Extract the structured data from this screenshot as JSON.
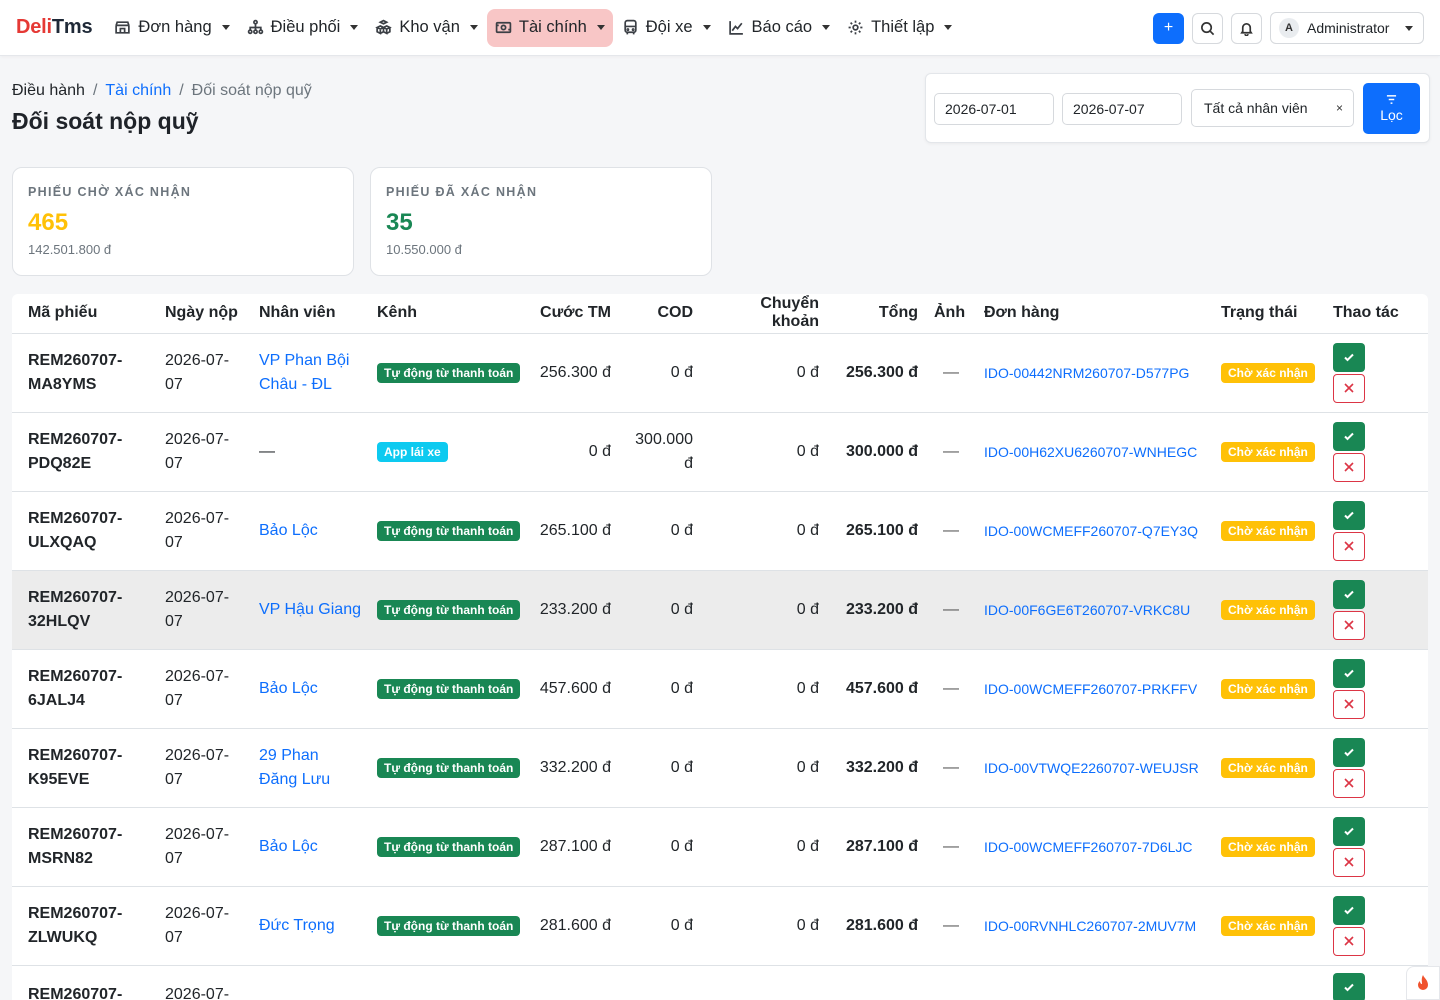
{
  "brand": {
    "part1": "Deli",
    "part2": "Tms"
  },
  "nav": [
    {
      "label": "Đơn hàng",
      "icon": "store-icon",
      "active": false
    },
    {
      "label": "Điều phối",
      "icon": "network-icon",
      "active": false
    },
    {
      "label": "Kho vận",
      "icon": "boxes-icon",
      "active": false
    },
    {
      "label": "Tài chính",
      "icon": "cash-icon",
      "active": true
    },
    {
      "label": "Đội xe",
      "icon": "bus-icon",
      "active": false
    },
    {
      "label": "Báo cáo",
      "icon": "chart-line-icon",
      "active": false
    },
    {
      "label": "Thiết lập",
      "icon": "gear-icon",
      "active": false
    }
  ],
  "navbar_right": {
    "add": "+",
    "user_initial": "A",
    "user_name": "Administrator"
  },
  "breadcrumb": {
    "root": "Điều hành",
    "parent": "Tài chính",
    "current": "Đối soát nộp quỹ"
  },
  "page_title": "Đối soát nộp quỹ",
  "filter": {
    "date_from": "2026-07-01",
    "date_to": "2026-07-07",
    "staff": "Tất cả nhân viên",
    "clear": "×",
    "button": "Lọc"
  },
  "stats": {
    "pending": {
      "label": "PHIẾU CHỜ XÁC NHẬN",
      "count": "465",
      "amount": "142.501.800 đ",
      "color": "#ffc107"
    },
    "confirmed": {
      "label": "PHIẾU ĐÃ XÁC NHẬN",
      "count": "35",
      "amount": "10.550.000 đ",
      "color": "#198754"
    }
  },
  "table": {
    "headers": [
      "Mã phiếu",
      "Ngày nộp",
      "Nhân viên",
      "Kênh",
      "Cước TM",
      "COD",
      "Chuyển khoản",
      "Tổng",
      "Ảnh",
      "Đơn hàng",
      "Trạng thái",
      "Thao tác"
    ],
    "rows": [
      {
        "code": "REM260707-MA8YMS",
        "date": "2026-07-07",
        "staff": "VP Phan Bội Châu - ĐL",
        "channel": "Tự động từ thanh toán",
        "channel_type": "auto",
        "cash": "256.300 đ",
        "cod": "0 đ",
        "transfer": "0 đ",
        "total": "256.300 đ",
        "img": "—",
        "order": "IDO-00442NRM260707-D577PG",
        "status": "Chờ xác nhận"
      },
      {
        "code": "REM260707-PDQ82E",
        "date": "2026-07-07",
        "staff": "—",
        "channel": "App lái xe",
        "channel_type": "app",
        "cash": "0 đ",
        "cod": "300.000 đ",
        "transfer": "0 đ",
        "total": "300.000 đ",
        "img": "—",
        "order": "IDO-00H62XU6260707-WNHEGC",
        "status": "Chờ xác nhận"
      },
      {
        "code": "REM260707-ULXQAQ",
        "date": "2026-07-07",
        "staff": "Bảo Lộc",
        "channel": "Tự động từ thanh toán",
        "channel_type": "auto",
        "cash": "265.100 đ",
        "cod": "0 đ",
        "transfer": "0 đ",
        "total": "265.100 đ",
        "img": "—",
        "order": "IDO-00WCMEFF260707-Q7EY3Q",
        "status": "Chờ xác nhận"
      },
      {
        "code": "REM260707-32HLQV",
        "date": "2026-07-07",
        "staff": "VP Hậu Giang",
        "channel": "Tự động từ thanh toán",
        "channel_type": "auto",
        "cash": "233.200 đ",
        "cod": "0 đ",
        "transfer": "0 đ",
        "total": "233.200 đ",
        "img": "—",
        "order": "IDO-00F6GE6T260707-VRKC8U",
        "status": "Chờ xác nhận",
        "highlight": true
      },
      {
        "code": "REM260707-6JALJ4",
        "date": "2026-07-07",
        "staff": "Bảo Lộc",
        "channel": "Tự động từ thanh toán",
        "channel_type": "auto",
        "cash": "457.600 đ",
        "cod": "0 đ",
        "transfer": "0 đ",
        "total": "457.600 đ",
        "img": "—",
        "order": "IDO-00WCMEFF260707-PRKFFV",
        "status": "Chờ xác nhận"
      },
      {
        "code": "REM260707-K95EVE",
        "date": "2026-07-07",
        "staff": "29 Phan Đăng Lưu",
        "channel": "Tự động từ thanh toán",
        "channel_type": "auto",
        "cash": "332.200 đ",
        "cod": "0 đ",
        "transfer": "0 đ",
        "total": "332.200 đ",
        "img": "—",
        "order": "IDO-00VTWQE2260707-WEUJSR",
        "status": "Chờ xác nhận"
      },
      {
        "code": "REM260707-MSRN82",
        "date": "2026-07-07",
        "staff": "Bảo Lộc",
        "channel": "Tự động từ thanh toán",
        "channel_type": "auto",
        "cash": "287.100 đ",
        "cod": "0 đ",
        "transfer": "0 đ",
        "total": "287.100 đ",
        "img": "—",
        "order": "IDO-00WCMEFF260707-7D6LJC",
        "status": "Chờ xác nhận"
      },
      {
        "code": "REM260707-ZLWUKQ",
        "date": "2026-07-07",
        "staff": "Đức Trọng",
        "channel": "Tự động từ thanh toán",
        "channel_type": "auto",
        "cash": "281.600 đ",
        "cod": "0 đ",
        "transfer": "0 đ",
        "total": "281.600 đ",
        "img": "—",
        "order": "IDO-00RVNHLC260707-2MUV7M",
        "status": "Chờ xác nhận"
      },
      {
        "code": "REM260707-",
        "date": "2026-07-",
        "staff": "",
        "channel": "",
        "channel_type": "auto",
        "cash": "",
        "cod": "",
        "transfer": "",
        "total": "",
        "img": "",
        "order": "",
        "status": "",
        "partial": true
      }
    ]
  }
}
